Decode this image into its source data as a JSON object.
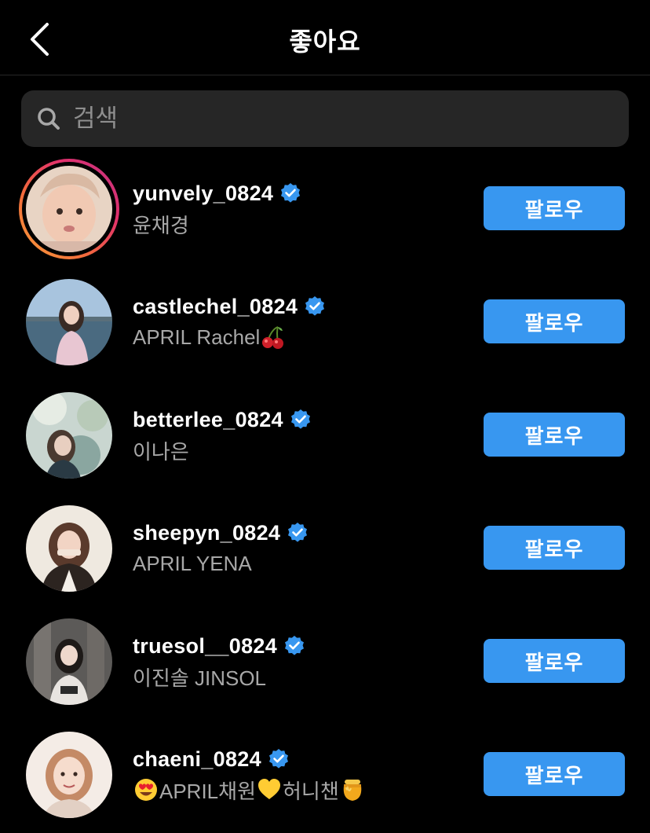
{
  "header": {
    "title": "좋아요",
    "back_icon": "chevron-left-icon"
  },
  "search": {
    "placeholder": "검색",
    "value": "",
    "icon": "search-icon"
  },
  "colors": {
    "background": "#000000",
    "follow_button": "#3897f0",
    "verified_badge": "#3897f0",
    "secondary_text": "#a8a8a8",
    "search_bg": "#262626"
  },
  "users": [
    {
      "username": "yunvely_0824",
      "name_parts": [
        "윤채경"
      ],
      "verified": true,
      "has_story": true,
      "follow_label": "팔로우"
    },
    {
      "username": "castlechel_0824",
      "name_parts": [
        "APRIL Rachel"
      ],
      "name_emoji_after": "cherries",
      "verified": true,
      "has_story": false,
      "follow_label": "팔로우"
    },
    {
      "username": "betterlee_0824",
      "name_parts": [
        "이나은"
      ],
      "verified": true,
      "has_story": false,
      "follow_label": "팔로우"
    },
    {
      "username": "sheepyn_0824",
      "name_parts": [
        "APRIL YENA"
      ],
      "verified": true,
      "has_story": false,
      "follow_label": "팔로우"
    },
    {
      "username": "truesol__0824",
      "name_parts": [
        "이진솔 JINSOL"
      ],
      "verified": true,
      "has_story": false,
      "follow_label": "팔로우"
    },
    {
      "username": "chaeni_0824",
      "name_parts": [
        "APRIL채원",
        "허니챈"
      ],
      "name_emojis": [
        "heart-eyes",
        "yellow-heart",
        "honey-pot"
      ],
      "verified": true,
      "has_story": false,
      "follow_label": "팔로우"
    }
  ]
}
